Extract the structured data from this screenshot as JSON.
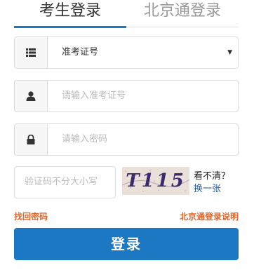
{
  "tabs": [
    {
      "label": "考生登录",
      "active": true
    },
    {
      "label": "北京通登录",
      "active": false
    }
  ],
  "form": {
    "id_type": {
      "value": "准考证号",
      "icon": "list-icon"
    },
    "id_number": {
      "placeholder": "请输入准考证号",
      "icon": "user-icon"
    },
    "password": {
      "placeholder": "请输入密码",
      "icon": "lock-icon"
    },
    "captcha": {
      "placeholder": "验证码不分大小写",
      "image_text": "T115",
      "hint": "看不清？",
      "refresh_label": "换一张"
    }
  },
  "links": {
    "forgot_password": "找回密码",
    "beijingtong_help": "北京通登录说明"
  },
  "submit_label": "登录",
  "colors": {
    "accent": "#1c78c2",
    "link": "#e0682c"
  }
}
